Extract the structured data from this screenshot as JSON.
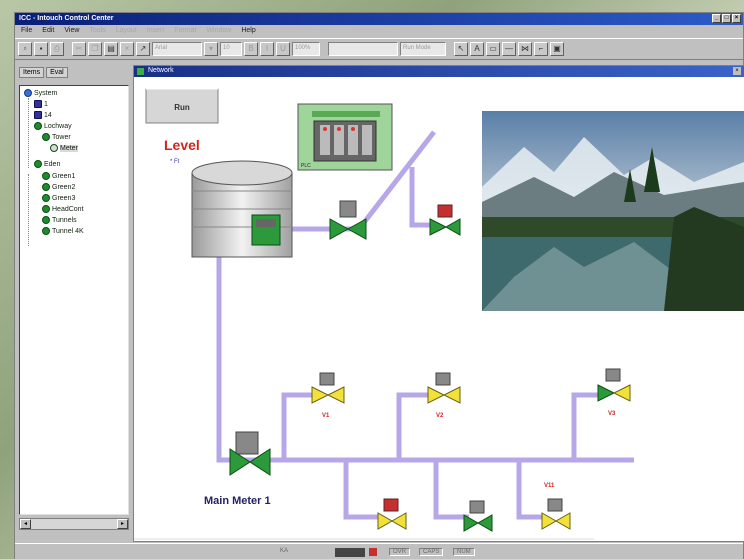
{
  "window": {
    "title": "ICC - Intouch Control Center",
    "controls": [
      "_",
      "□",
      "×"
    ]
  },
  "menu": {
    "items": [
      "File",
      "Edit",
      "View",
      "Help"
    ],
    "faded_items": [
      "Tools",
      "Layout",
      "Insert",
      "Format",
      "Window"
    ]
  },
  "toolbar": {
    "zoom_value": "100%",
    "font_value": "Arial",
    "size_value": "10",
    "mode_value": "Run Mode"
  },
  "left_pane": {
    "tabs": [
      "Items",
      "Eval"
    ],
    "tree": [
      {
        "label": "System",
        "icon": "system-icon"
      },
      {
        "label": "1",
        "icon": "module-icon"
      },
      {
        "label": "14",
        "icon": "module-icon"
      },
      {
        "label": "Lochway",
        "icon": "station-icon"
      },
      {
        "label": "Tower",
        "icon": "station-icon"
      },
      {
        "label": "Meter",
        "icon": "station-icon"
      },
      {
        "label": "Eden",
        "icon": "station-icon"
      },
      {
        "label": "Green1",
        "icon": "station-icon"
      },
      {
        "label": "Green2",
        "icon": "station-icon"
      },
      {
        "label": "Green3",
        "icon": "station-icon"
      },
      {
        "label": "HeadCont",
        "icon": "station-icon"
      },
      {
        "label": "Tunnels",
        "icon": "station-icon"
      },
      {
        "label": "Tunnel 4K",
        "icon": "station-icon"
      }
    ]
  },
  "canvas": {
    "title": "Network",
    "button_label": "Run",
    "level_label": "Level",
    "level_value": "* Ft",
    "panel_label": "PLC",
    "meter_label": "Main Meter 1",
    "valve_labels": [
      "V1",
      "V2",
      "V3"
    ],
    "valve_labels_lower": [
      "V11"
    ]
  },
  "status": {
    "left": "KA",
    "caps": "CAPS",
    "num": "NUM",
    "ovr": "OVR"
  },
  "colors": {
    "titlebar": "#0a1f78",
    "pipe": "#b7a6e8",
    "valve_green": "#2c9a3a",
    "valve_yellow": "#f2e13a",
    "level_red": "#d4231c",
    "meter_text": "#222266"
  }
}
